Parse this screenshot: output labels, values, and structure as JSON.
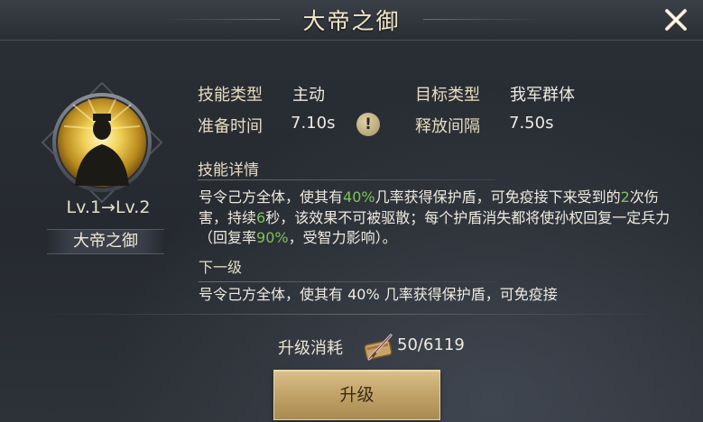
{
  "header": {
    "title": "大帝之御"
  },
  "skill": {
    "level_text": "Lv.1→Lv.2",
    "name": "大帝之御"
  },
  "info": {
    "type_label": "技能类型",
    "type_value": "主动",
    "target_label": "目标类型",
    "target_value": "我军群体",
    "prep_label": "准备时间",
    "prep_value": "7.10s",
    "interval_label": "释放间隔",
    "interval_value": "7.50s",
    "info_icon_glyph": "!"
  },
  "details": {
    "heading": "技能详情",
    "p1": "号令己方全体，使其有",
    "v1": "40%",
    "p2": "几率获得保护盾，可免疫接下来受到的",
    "v2": "2",
    "p3": "次伤害，持续",
    "v3": "6",
    "p4": "秒，该效果不可被驱散；每个护盾消失都将使孙权回复一定兵力（回复率",
    "v4": "90%",
    "p5": "，受智力影响）。",
    "next_heading": "下一级",
    "next_peek": "号令己方全体，使其有 40% 几率获得保护盾，可免疫接"
  },
  "cost": {
    "label": "升级消耗",
    "value": "50/6119",
    "icon": "scroll-sword-icon"
  },
  "buttons": {
    "upgrade": "升级"
  },
  "colors": {
    "highlight_green": "#7dc45a",
    "gold_text": "#e7dcc0",
    "button_gold": "#c3a56a"
  }
}
